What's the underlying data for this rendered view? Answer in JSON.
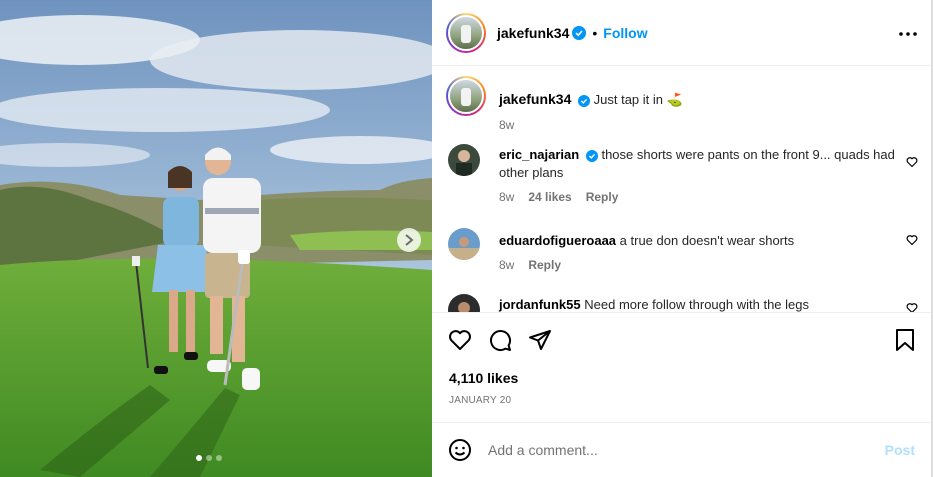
{
  "post": {
    "author": "jakefunk34",
    "follow_label": "Follow",
    "separator": "•",
    "caption_author": "jakefunk34",
    "caption": "Just tap it in ⛳",
    "caption_age": "8w"
  },
  "photo": {
    "slide_count": 3,
    "active_slide": 1
  },
  "comments": [
    {
      "user": "eric_najarian",
      "verified": true,
      "text": "those shorts were pants on the front 9... quads had other plans",
      "age": "8w",
      "likes": "24 likes",
      "reply": "Reply"
    },
    {
      "user": "eduardofigueroaaa",
      "verified": false,
      "text": "a true don doesn't wear shorts",
      "age": "8w",
      "likes": "",
      "reply": "Reply"
    },
    {
      "user": "jordanfunk55",
      "verified": false,
      "text": "Need more follow through with the legs",
      "age": "",
      "likes": "",
      "reply": ""
    }
  ],
  "stats": {
    "likes": "4,110 likes",
    "date": "JANUARY 20"
  },
  "composer": {
    "placeholder": "Add a comment...",
    "post_label": "Post"
  },
  "colors": {
    "accent": "#0095f6",
    "verified": "#0095f6",
    "post_disabled": "#b2dffc",
    "meta_text": "#737373"
  },
  "icons": [
    "verified-icon",
    "more-icon",
    "heart-icon",
    "comment-icon",
    "share-icon",
    "bookmark-icon",
    "emoji-icon",
    "chevron-right-icon"
  ]
}
